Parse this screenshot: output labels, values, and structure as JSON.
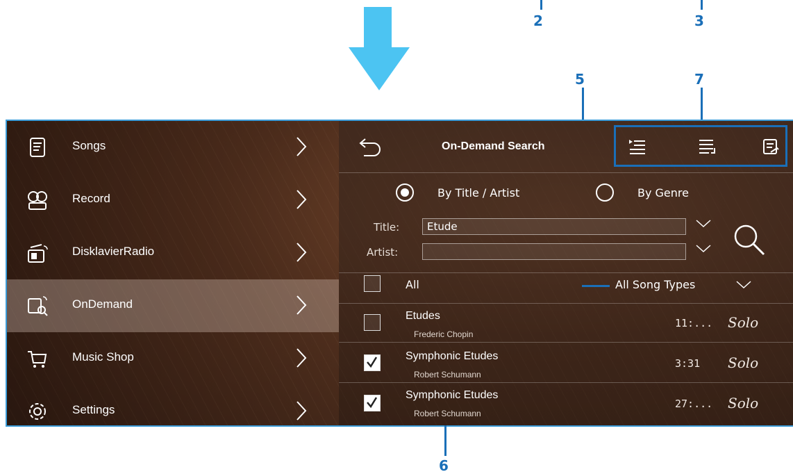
{
  "callouts": {
    "c2": "2",
    "c3": "3",
    "c5": "5",
    "c7": "7",
    "c6": "6"
  },
  "sidebar": {
    "items": [
      {
        "label": "Songs",
        "icon": "songs-icon"
      },
      {
        "label": "Record",
        "icon": "record-icon"
      },
      {
        "label": "DisklavierRadio",
        "icon": "radio-icon"
      },
      {
        "label": "OnDemand",
        "icon": "ondemand-icon",
        "selected": true
      },
      {
        "label": "Music Shop",
        "icon": "cart-icon"
      },
      {
        "label": "Settings",
        "icon": "gear-icon"
      }
    ]
  },
  "header": {
    "title": "On-Demand Search"
  },
  "search": {
    "by_title_label": "By Title / Artist",
    "by_genre_label": "By Genre",
    "title_label": "Title:",
    "title_value": "Etude",
    "artist_label": "Artist:",
    "artist_value": ""
  },
  "list": {
    "all_label": "All",
    "song_types": "All Song Types",
    "rows": [
      {
        "title": "Etudes",
        "artist": "Frederic Chopin",
        "time": "11:...",
        "type": "Solo",
        "checked": false
      },
      {
        "title": "Symphonic Etudes",
        "artist": "Robert Schumann",
        "time": "3:31",
        "type": "Solo",
        "checked": true
      },
      {
        "title": "Symphonic Etudes",
        "artist": "Robert Schumann",
        "time": "27:...",
        "type": "Solo",
        "checked": true
      }
    ]
  },
  "colors": {
    "callout": "#1a6fb8",
    "arrow": "#4cc4f2",
    "frame": "#3a9bd8"
  }
}
